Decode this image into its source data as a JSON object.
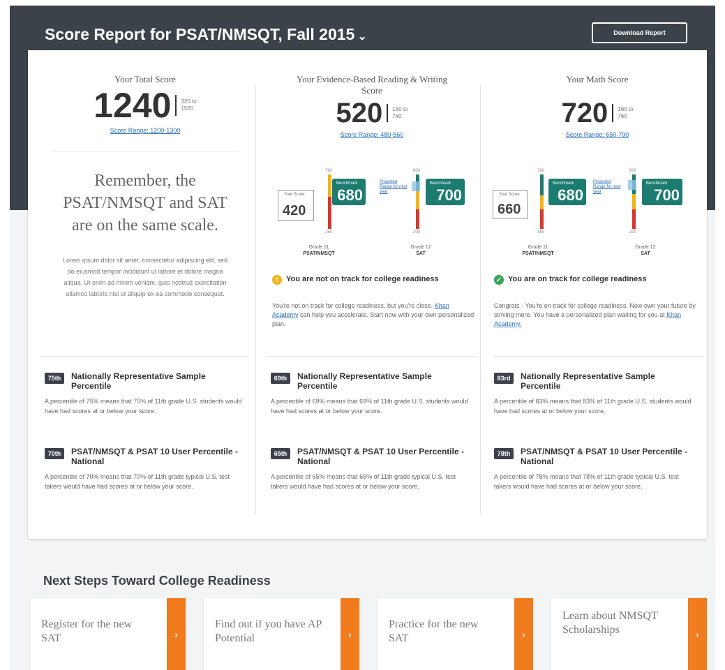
{
  "header": {
    "title": "Score Report for PSAT/NMSQT, Fall 2015",
    "chevron": "⌄",
    "download_label": "Download Report"
  },
  "total": {
    "title": "Your Total Score",
    "score": "1240",
    "range_small_1": "320 to",
    "range_small_2": "1520",
    "range_link": "Score Range: 1200-1300",
    "remember": "Remember, the PSAT/NMSQT and SAT are on the same scale.",
    "lorem": "Lorem ipsum dolor sit amet, consectetur adipiscing elit, sed do eiusmod tempor incididunt ut labore et dolore magna aliqua. Ut enim ad minim veniam, quis nostrud exercitation ullamco laboris nisi ut aliquip ex ea commodo consequat."
  },
  "ebrw": {
    "title": "Your Evidence-Based Reading & Writing Score",
    "score": "520",
    "range_small_1": "160 to",
    "range_small_2": "760",
    "range_link": "Score Range: 480-560",
    "your_score_label": "Your Score",
    "your_score": "420",
    "benchmark_label": "Benchmark",
    "benchmark_psat": "680",
    "benchmark_sat": "700",
    "projected_label": "Projected Range for next year",
    "tick_top_1": "760",
    "tick_bot_1": "160",
    "tick_top_2": "800",
    "tick_bot_2": "200",
    "grade_1": "Grade 11",
    "test_1": "PSAT/NMSQT",
    "grade_2": "Grade 12",
    "test_2": "SAT",
    "status_title": "You are not on track for college readiness",
    "status_desc_1": "You're not on track for college readiness, but you're close.",
    "status_link": "Khan Academy",
    "status_desc_2": "can help you accelerate. Start now with your own personalized plan."
  },
  "math": {
    "title": "Your Math Score",
    "score": "720",
    "range_small_1": "160 to",
    "range_small_2": "760",
    "range_link": "Score Range: 650-790",
    "your_score_label": "Your Score",
    "your_score": "660",
    "benchmark_label": "Benchmark",
    "benchmark_psat": "680",
    "benchmark_sat": "700",
    "projected_label": "Projected Range for next year",
    "tick_top_1": "760",
    "tick_bot_1": "160",
    "tick_top_2": "800",
    "tick_bot_2": "200",
    "grade_1": "Grade 11",
    "test_1": "PSAT/NMSQT",
    "grade_2": "Grade 12",
    "test_2": "SAT",
    "status_title": "You are on track for college readiness",
    "status_desc_1": "Congrats - You're on track for college readiness. Now own your future by striving more. You have a personalized plan waiting for you at",
    "status_link": "Khan Academy."
  },
  "percentiles": {
    "col1": [
      {
        "badge": "75th",
        "title": "Nationally Representative Sample Percentile",
        "desc": "A percentile of 75% means that 75% of 11th grade U.S. students would have had scores at or below your score."
      },
      {
        "badge": "70th",
        "title": "PSAT/NMSQT & PSAT 10 User Percentile - National",
        "desc": "A percentile of 70% means that 70% of 11th grade typical U.S. test takers would have had scores at or below your score."
      }
    ],
    "col2": [
      {
        "badge": "69th",
        "title": "Nationally Representative Sample Percentile",
        "desc": "A percentile of 69% means that 69% of 11th grade U.S. students would have had scores at or below your score."
      },
      {
        "badge": "65th",
        "title": "PSAT/NMSQT & PSAT 10 User Percentile - National",
        "desc": "A percentile of 65% means that 65% of 11th grade typical U.S. test takers would have had scores at or below your score."
      }
    ],
    "col3": [
      {
        "badge": "83rd",
        "title": "Nationally Representative Sample Percentile",
        "desc": "A percentile of 83% means that 83% of 11th grade U.S. students would have had scores at or below your score."
      },
      {
        "badge": "78th",
        "title": "PSAT/NMSQT & PSAT 10 User Percentile - National",
        "desc": "A percentile of 78% means that 78% of 11th grade typical U.S. test takers would have had scores at or below your score."
      }
    ]
  },
  "next_steps": {
    "title": "Next Steps Toward College Readiness",
    "arrow": "›",
    "cards": [
      {
        "label": "Register for the new SAT"
      },
      {
        "label": "Find out if you have AP Potential"
      },
      {
        "label": "Practice for the new SAT"
      },
      {
        "label": "Learn about NMSQT Scholarships"
      }
    ]
  },
  "colors": {
    "header_bg": "#3b4249",
    "benchmark_green": "#1c7c70",
    "link_blue": "#2a6ebb",
    "next_step_orange": "#f07c1e",
    "warning_yellow": "#f2b418",
    "success_green": "#3aa35a"
  }
}
